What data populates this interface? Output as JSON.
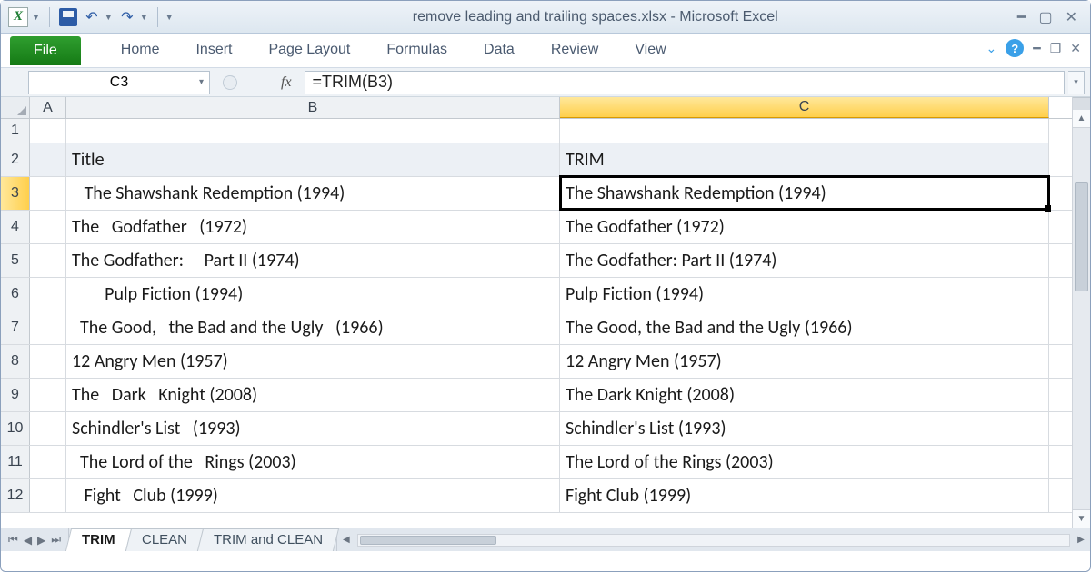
{
  "window": {
    "title": "remove leading and trailing spaces.xlsx  -  Microsoft Excel"
  },
  "ribbon": {
    "file": "File",
    "tabs": [
      "Home",
      "Insert",
      "Page Layout",
      "Formulas",
      "Data",
      "Review",
      "View"
    ]
  },
  "formula_bar": {
    "name_box": "C3",
    "fx_label": "fx",
    "formula": "=TRIM(B3)"
  },
  "columns": [
    "A",
    "B",
    "C"
  ],
  "row_numbers": [
    "1",
    "2",
    "3",
    "4",
    "5",
    "6",
    "7",
    "8",
    "9",
    "10",
    "11",
    "12"
  ],
  "active_cell": "C3",
  "headers": {
    "B": "Title",
    "C": "TRIM"
  },
  "rows": [
    {
      "B": "   The Shawshank Redemption (1994)",
      "C": "The Shawshank Redemption (1994)"
    },
    {
      "B": "The   Godfather   (1972)",
      "C": "The Godfather (1972)"
    },
    {
      "B": "The Godfather:     Part II (1974)",
      "C": "The Godfather: Part II (1974)"
    },
    {
      "B": "        Pulp Fiction (1994)",
      "C": "Pulp Fiction (1994)"
    },
    {
      "B": "  The Good,   the Bad and the Ugly   (1966)",
      "C": "The Good, the Bad and the Ugly (1966)"
    },
    {
      "B": "12 Angry Men (1957)",
      "C": "12 Angry Men (1957)"
    },
    {
      "B": "The   Dark   Knight (2008)",
      "C": "The Dark Knight (2008)"
    },
    {
      "B": "Schindler's List   (1993)",
      "C": "Schindler's List (1993)"
    },
    {
      "B": "  The Lord of the   Rings (2003)",
      "C": "The Lord of the Rings (2003)"
    },
    {
      "B": "   Fight   Club (1999)",
      "C": "Fight Club (1999)"
    }
  ],
  "sheet_tabs": {
    "active": "TRIM",
    "tabs": [
      "TRIM",
      "CLEAN",
      "TRIM and CLEAN"
    ]
  }
}
